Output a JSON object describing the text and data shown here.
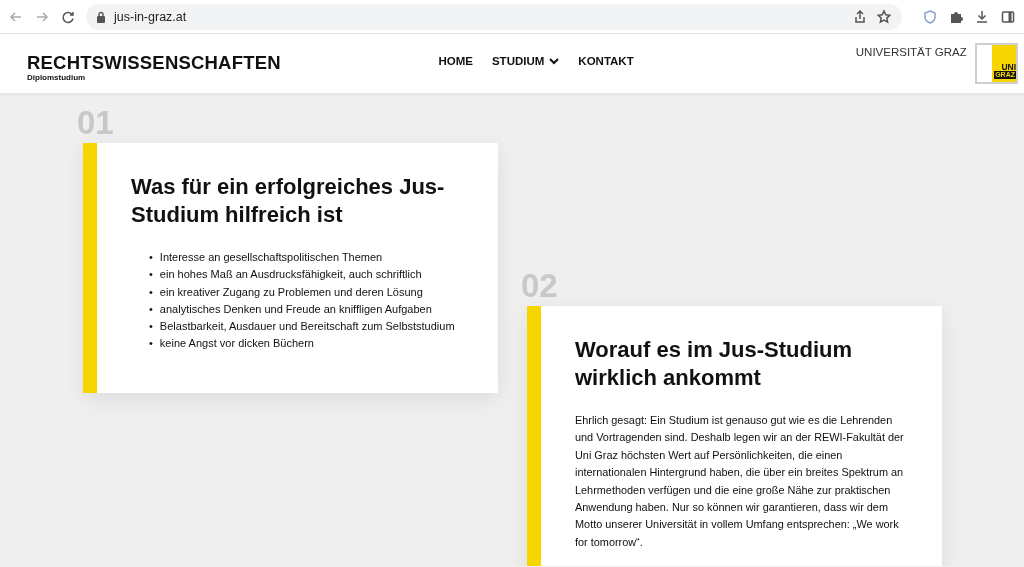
{
  "browser": {
    "url": "jus-in-graz.at"
  },
  "header": {
    "title": "RECHTSWISSENSCHAFTEN",
    "subtitle": "Diplomstudium",
    "university": "UNIVERSITÄT GRAZ",
    "logo": [
      "UNI",
      "GRAZ"
    ],
    "nav": [
      {
        "label": "HOME",
        "dropdown": false
      },
      {
        "label": "STUDIUM",
        "dropdown": true
      },
      {
        "label": "KONTAKT",
        "dropdown": false
      }
    ]
  },
  "cards": [
    {
      "number": "01",
      "kind": "list",
      "bullet": "•",
      "title": "Was für ein erfolgreiches Jus-Studium hilfreich ist",
      "items": [
        "Interesse an gesellschaftspolitischen Themen",
        "ein hohes Maß an Ausdrucksfähigkeit, auch schriftlich",
        "ein kreativer Zugang zu Problemen und deren Lösung",
        "analytisches Denken und Freude an kniffligen Aufgaben",
        "Belastbarkeit, Ausdauer und Bereitschaft zum Selbststudium",
        "keine Angst vor dicken Büchern"
      ]
    },
    {
      "number": "02",
      "kind": "text",
      "title": "Worauf es im Jus-Studium wirklich ankommt",
      "text": "Ehrlich gesagt: Ein Studium ist genauso gut wie es die Lehrenden und Vortragenden sind. Deshalb legen wir an der REWI-Fakultät der Uni Graz höchsten Wert auf Persönlichkeiten, die einen internationalen Hintergrund haben, die über ein breites Spektrum an Lehrmethoden verfügen und die eine große Nähe zur praktischen Anwendung haben. Nur so können wir garantieren, dass wir dem Motto unserer Universität in vollem Umfang entsprechen: „We work for tomorrow“."
    }
  ]
}
